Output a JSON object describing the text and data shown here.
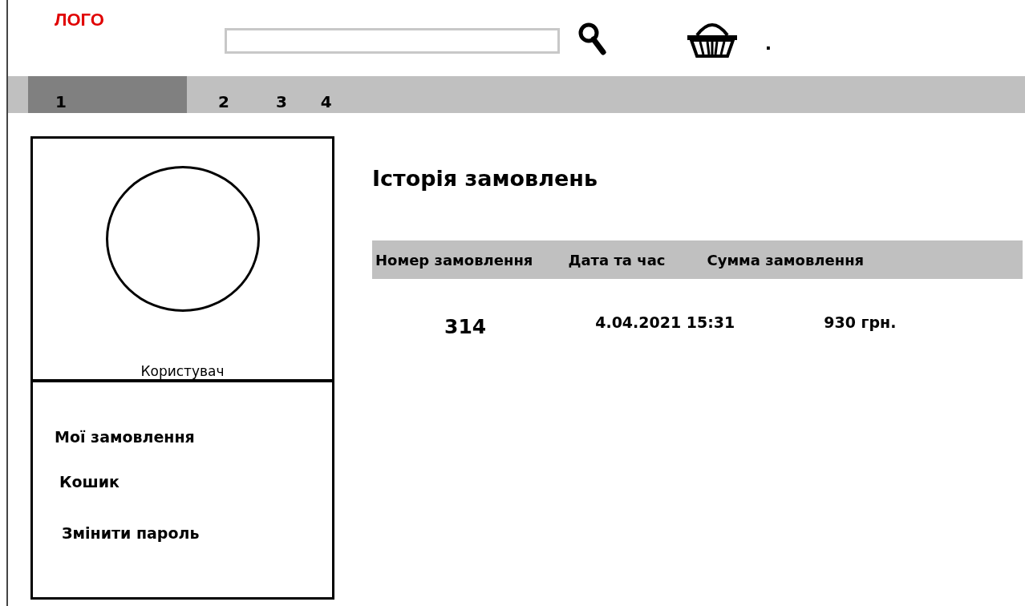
{
  "logo": "ЛОГО",
  "cart_mark": ".",
  "tabs": [
    {
      "label": "1",
      "selected": true
    },
    {
      "label": "2",
      "selected": false
    },
    {
      "label": "3",
      "selected": false
    },
    {
      "label": "4",
      "selected": false
    }
  ],
  "profile": {
    "name": "Користувач"
  },
  "menu": [
    {
      "label": "Мої замовлення"
    },
    {
      "label": "Кошик"
    },
    {
      "label": "Змінити пароль"
    }
  ],
  "heading": "Історія замовлень",
  "table": {
    "columns": [
      "Номер замовлення",
      "Дата та час",
      "Сумма замовлення"
    ],
    "rows": [
      [
        "314",
        "4.04.2021 15:31",
        "930 грн."
      ]
    ]
  }
}
